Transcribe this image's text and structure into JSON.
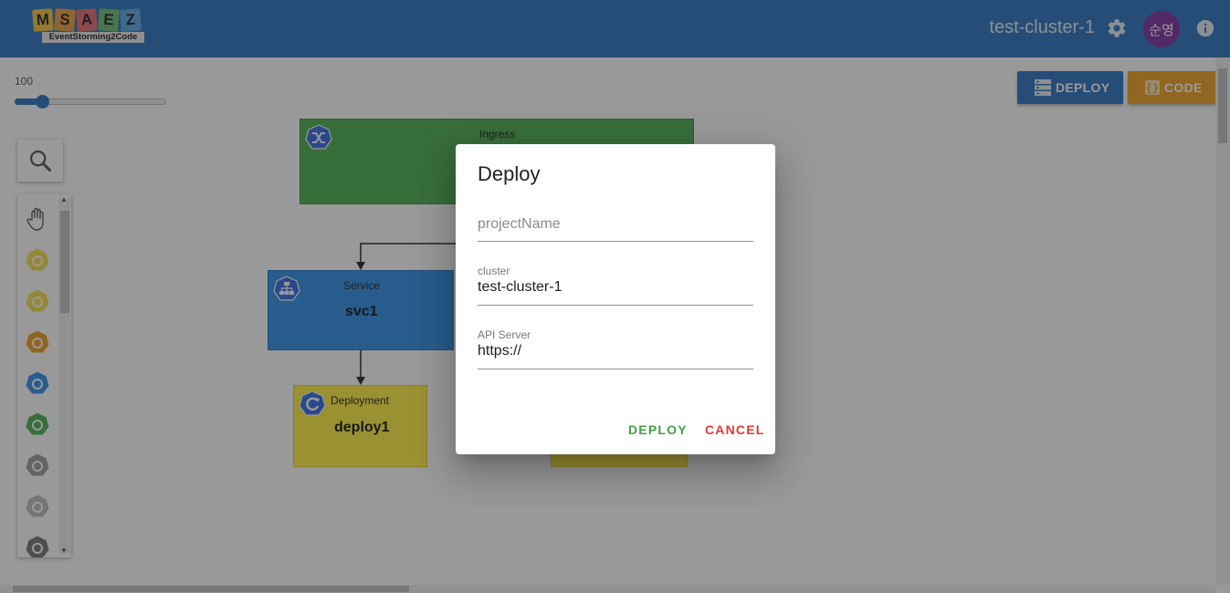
{
  "header": {
    "logo_letters": [
      {
        "char": "M",
        "color": "#f5c542"
      },
      {
        "char": "S",
        "color": "#f0a040"
      },
      {
        "char": "A",
        "color": "#e87070"
      },
      {
        "char": "E",
        "color": "#6fbf73"
      },
      {
        "char": "Z",
        "color": "#5aa9e6"
      }
    ],
    "logo_subtitle": "EventStorming2Code",
    "cluster_name": "test-cluster-1",
    "avatar_text": "순영"
  },
  "toolbar": {
    "zoom_value": "100",
    "zoom_level": 0.18,
    "deploy_label": "DEPLOY",
    "code_label": "CODE"
  },
  "palette": {
    "items": [
      {
        "name": "hand-tool-icon",
        "color": "#555555"
      },
      {
        "name": "deployment-icon",
        "color": "#f5e04a"
      },
      {
        "name": "replicaset-icon",
        "color": "#f5e04a"
      },
      {
        "name": "pod-icon",
        "color": "#f0a020"
      },
      {
        "name": "service-icon",
        "color": "#2f8fe8"
      },
      {
        "name": "ingress-icon",
        "color": "#4caf50"
      },
      {
        "name": "volume-icon",
        "color": "#9e9e9e"
      },
      {
        "name": "persistent-volume-icon",
        "color": "#bdbdbd"
      },
      {
        "name": "storage-icon",
        "color": "#757575"
      }
    ]
  },
  "diagram": {
    "ingress": {
      "type": "Ingress",
      "name": ""
    },
    "service": {
      "type": "Service",
      "name": "svc1"
    },
    "deployment": {
      "type": "Deployment",
      "name": "deploy1"
    }
  },
  "dialog": {
    "title": "Deploy",
    "fields": {
      "project_name": {
        "label": "",
        "value": "",
        "placeholder": "projectName"
      },
      "cluster": {
        "label": "cluster",
        "value": "test-cluster-1"
      },
      "api_server": {
        "label": "API Server",
        "value": "https://"
      }
    },
    "deploy_label": "DEPLOY",
    "cancel_label": "CANCEL"
  }
}
